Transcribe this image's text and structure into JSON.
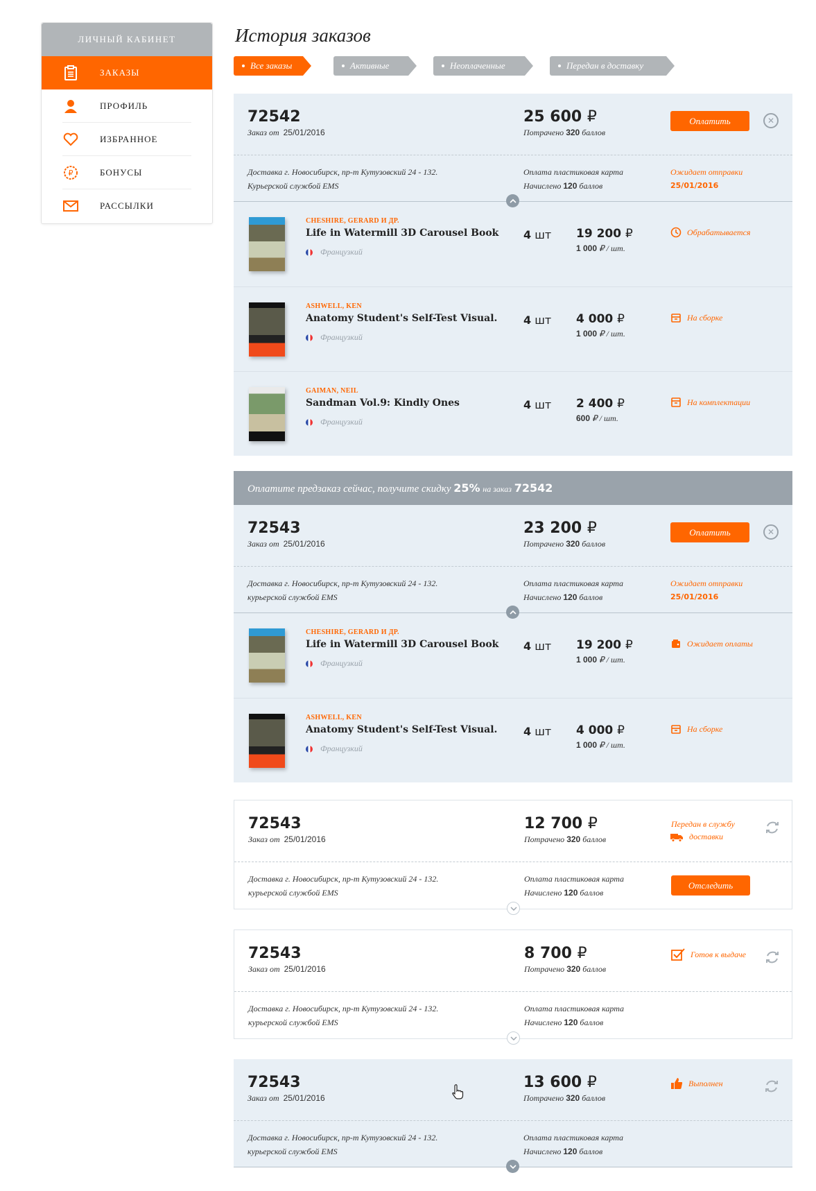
{
  "sidebar": {
    "header": "ЛИЧНЫЙ КАБИНЕТ",
    "items": [
      {
        "label": "ЗАКАЗЫ",
        "icon": "clipboard-icon"
      },
      {
        "label": "ПРОФИЛЬ",
        "icon": "user-icon"
      },
      {
        "label": "ИЗБРАННОЕ",
        "icon": "heart-icon"
      },
      {
        "label": "БОНУСЫ",
        "icon": "ruble-badge-icon"
      },
      {
        "label": "РАССЫЛКИ",
        "icon": "envelope-icon"
      }
    ]
  },
  "page": {
    "title": "История заказов",
    "tabs": [
      "Все заказы",
      "Активные",
      "Неоплаченные",
      "Передан в доставку"
    ]
  },
  "colors": {
    "accent": "#ff6600",
    "gray": "#b1b5b8",
    "card_blue": "#e8eff5"
  },
  "common": {
    "order_from": "Заказ от",
    "spent_prefix": "Потрачено",
    "points_suffix": "баллов",
    "accrued_prefix": "Начислено",
    "payment": "Оплата пластиковая карта",
    "delivery_line1": "Доставка  г. Новосибирск, пр-т Кутузовский 24 - 132.",
    "pay_button": "Оплатить",
    "track_button": "Отследить",
    "currency": "₽",
    "qty_unit": "шт",
    "per_unit": "/ шт.",
    "language": "Французкий"
  },
  "orders": [
    {
      "number": "72542",
      "date": "25/01/2016",
      "total": "25 600",
      "spent": "320",
      "accrued": "120",
      "delivery_line2": "Курьерской службой EMS",
      "status_line1": "Ожидает отправки",
      "status_line2": "25/01/2016",
      "items": [
        {
          "author": "CHESHIRE, GERARD И ДР.",
          "title": "Life in Watermill 3D Carousel Book",
          "qty": "4",
          "price": "19 200",
          "unit_price": "1 000",
          "status": "Обрабатывается"
        },
        {
          "author": "ASHWELL, KEN",
          "title": "Anatomy Student's Self-Test Visual.",
          "qty": "4",
          "price": "4 000",
          "unit_price": "1 000",
          "status": "На сборке"
        },
        {
          "author": "GAIMAN, NEIL",
          "title": "Sandman Vol.9: Kindly Ones",
          "qty": "4",
          "price": "2 400",
          "unit_price": "600",
          "status": "На комплектации"
        }
      ]
    },
    {
      "promo": {
        "text": "Оплатите предзаказ сейчас, получите скидку",
        "discount": "25%",
        "suffix": "на заказ",
        "order": "72542"
      },
      "number": "72543",
      "date": "25/01/2016",
      "total": "23 200",
      "spent": "320",
      "accrued": "120",
      "delivery_line2": "курьерской службой EMS",
      "status_line1": "Ожидает отправки",
      "status_line2": "25/01/2016",
      "items": [
        {
          "author": "CHESHIRE, GERARD И ДР.",
          "title": "Life in Watermill 3D Carousel Book",
          "qty": "4",
          "price": "19 200",
          "unit_price": "1 000",
          "status": "Ожидает оплаты"
        },
        {
          "author": "ASHWELL, KEN",
          "title": "Anatomy Student's Self-Test Visual.",
          "qty": "4",
          "price": "4 000",
          "unit_price": "1 000",
          "status": "На сборке"
        }
      ]
    },
    {
      "number": "72543",
      "date": "25/01/2016",
      "total": "12 700",
      "spent": "320",
      "accrued": "120",
      "delivery_line2": "курьерской службой EMS",
      "status_line1": "Передан в службу",
      "status_line2": "доставки"
    },
    {
      "number": "72543",
      "date": "25/01/2016",
      "total": "8 700",
      "spent": "320",
      "accrued": "120",
      "delivery_line2": "курьерской службой EMS",
      "status": "Готов к выдаче"
    },
    {
      "number": "72543",
      "date": "25/01/2016",
      "total": "13 600",
      "spent": "320",
      "accrued": "120",
      "delivery_line2": "курьерской службой EMS",
      "status": "Выполнен"
    }
  ]
}
